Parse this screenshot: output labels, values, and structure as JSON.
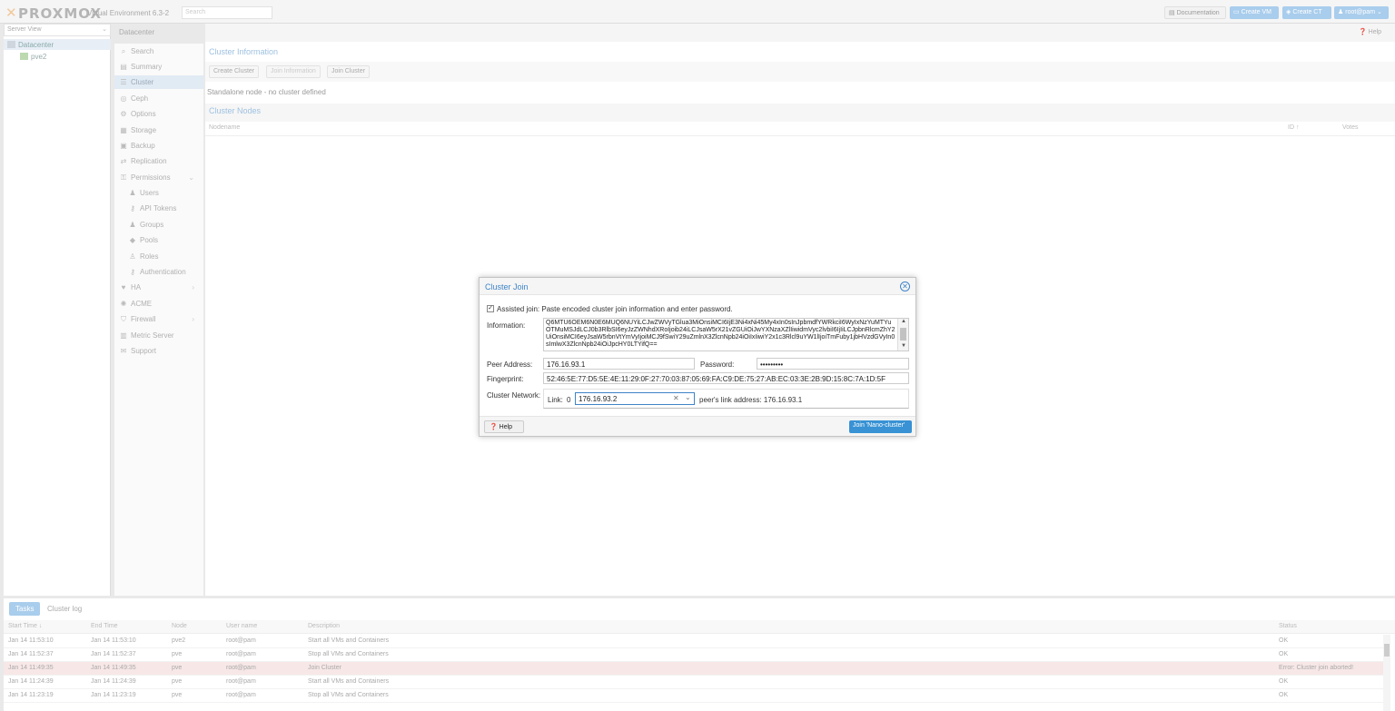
{
  "header": {
    "logo": "PROXMOX",
    "version": "Virtual Environment 6.3-2",
    "search_placeholder": "Search",
    "documentation": "Documentation",
    "create_vm": "Create VM",
    "create_ct": "Create CT",
    "user": "root@pam"
  },
  "tree": {
    "view": "Server View",
    "items": [
      {
        "label": "Datacenter"
      },
      {
        "label": "pve2"
      }
    ]
  },
  "breadcrumb": "Datacenter",
  "help_top": "Help",
  "menu": [
    {
      "label": "Search",
      "icon": "search-icon"
    },
    {
      "label": "Summary",
      "icon": "book-icon"
    },
    {
      "label": "Cluster",
      "icon": "server-icon"
    },
    {
      "label": "Ceph",
      "icon": "ceph-icon"
    },
    {
      "label": "Options",
      "icon": "gear-icon"
    },
    {
      "label": "Storage",
      "icon": "database-icon"
    },
    {
      "label": "Backup",
      "icon": "floppy-icon"
    },
    {
      "label": "Replication",
      "icon": "retweet-icon"
    },
    {
      "label": "Permissions",
      "icon": "unlock-icon"
    },
    {
      "label": "Users",
      "icon": "user-icon"
    },
    {
      "label": "API Tokens",
      "icon": "key-icon"
    },
    {
      "label": "Groups",
      "icon": "users-icon"
    },
    {
      "label": "Pools",
      "icon": "tags-icon"
    },
    {
      "label": "Roles",
      "icon": "male-icon"
    },
    {
      "label": "Authentication",
      "icon": "key-icon"
    },
    {
      "label": "HA",
      "icon": "heartbeat-icon"
    },
    {
      "label": "ACME",
      "icon": "certificate-icon"
    },
    {
      "label": "Firewall",
      "icon": "shield-icon"
    },
    {
      "label": "Metric Server",
      "icon": "bar-chart-icon"
    },
    {
      "label": "Support",
      "icon": "comments-icon"
    }
  ],
  "cluster": {
    "info_title": "Cluster Information",
    "create_btn": "Create Cluster",
    "join_info_btn": "Join Information",
    "join_btn": "Join Cluster",
    "standalone": "Standalone node - no cluster defined",
    "nodes_title": "Cluster Nodes",
    "col_nodename": "Nodename",
    "col_id": "ID ↑",
    "col_votes": "Votes"
  },
  "dialog": {
    "title": "Cluster Join",
    "assisted": "Assisted join: Paste encoded cluster join information and enter password.",
    "info_label": "Information:",
    "info_value": "Q6MTU6OEM6N0E6MUQ6NUYiLCJwZWVyTGlua3MiOnsiMCI6IjE3Ni4xNi45My4xIn0sInJpbmdfYWRkciI6WyIxNzYuMTYuOTMuMSJdLCJ0b3RlbSI6eyJzZWNhdXRoIjoib24iLCJsaW5rX21vZGUiOiJwYXNzaXZlIiwidmVyc2lvbiI6IjIiLCJpbnRlcmZhY2UiOnsiMCI6eyJsaW5rbnVtYmVyIjoiMCJ9fSwiY29uZmlnX3ZlcnNpb24iOiIxIiwiY2x1c3Rlcl9uYW1lIjoiTmFuby1jbHVzdGVyIn0sImlwX3ZlcnNpb24iOiJpcHY0LTYifQ==",
    "peer_label": "Peer Address:",
    "peer_value": "176.16.93.1",
    "pw_label": "Password:",
    "pw_value": "•••••••••",
    "fp_label": "Fingerprint:",
    "fp_value": "52:46:5E:77:D5:5E:4E:11:29:0F:27:70:03:87:05:69:FA:C9:DE:75:27:AB:EC:03:3E:2B:9D:15:8C:7A:1D:5F",
    "net_label": "Cluster Network:",
    "link_label": "Link:",
    "link_num": "0",
    "link_value": "176.16.93.2",
    "peer_link": "peer's link address: 176.16.93.1",
    "help_btn": "Help",
    "join_btn": "Join 'Nano-cluster'"
  },
  "tasklog": {
    "tabs": [
      "Tasks",
      "Cluster log"
    ],
    "columns": [
      "Start Time ↓",
      "End Time",
      "Node",
      "User name",
      "Description",
      "Status"
    ],
    "rows": [
      {
        "start": "Jan 14 11:53:10",
        "end": "Jan 14 11:53:10",
        "node": "pve2",
        "user": "root@pam",
        "desc": "Start all VMs and Containers",
        "status": "OK"
      },
      {
        "start": "Jan 14 11:52:37",
        "end": "Jan 14 11:52:37",
        "node": "pve",
        "user": "root@pam",
        "desc": "Stop all VMs and Containers",
        "status": "OK"
      },
      {
        "start": "Jan 14 11:49:35",
        "end": "Jan 14 11:49:35",
        "node": "pve",
        "user": "root@pam",
        "desc": "Join Cluster",
        "status": "Error: Cluster join aborted!"
      },
      {
        "start": "Jan 14 11:24:39",
        "end": "Jan 14 11:24:39",
        "node": "pve",
        "user": "root@pam",
        "desc": "Start all VMs and Containers",
        "status": "OK"
      },
      {
        "start": "Jan 14 11:23:19",
        "end": "Jan 14 11:23:19",
        "node": "pve",
        "user": "root@pam",
        "desc": "Stop all VMs and Containers",
        "status": "OK"
      }
    ]
  }
}
